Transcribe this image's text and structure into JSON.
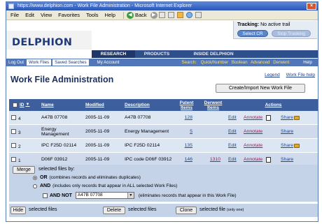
{
  "window": {
    "title": "https://www.delphion.com - Work File Administration - Microsoft Internet Explorer",
    "close_glyph": "×"
  },
  "menubar": {
    "items": [
      "File",
      "Edit",
      "View",
      "Favorites",
      "Tools",
      "Help"
    ],
    "back_label": "Back"
  },
  "tracking": {
    "label": "Tracking:",
    "status": "No active trail",
    "select_cr": "Select CR",
    "stop_tracking": "Stop Tracking"
  },
  "brand": {
    "logo": "DELPHION"
  },
  "nav": {
    "tabs": [
      "RESEARCH",
      "PRODUCTS",
      "INSIDE DELPHION"
    ]
  },
  "subnav": {
    "log_out": "Log Out",
    "work_files": "Work Files",
    "saved_searches": "Saved Searches",
    "my_account": "My Account",
    "search_label": "Search:",
    "quick_number": "Quick/Number",
    "boolean": "Boolean",
    "advanced": "Advanced",
    "derwent": "Derwent",
    "help": "Help"
  },
  "page": {
    "title": "Work File Administration",
    "legend": "Legend",
    "work_file_help": "Work File help",
    "create_button": "Create/Import New Work File"
  },
  "table": {
    "headers": {
      "id": "ID",
      "name": "Name",
      "modified": "Modified",
      "description": "Description",
      "patent_items": "Patent Items",
      "derwent_items": "Derwent Items",
      "actions": "Actions"
    },
    "rows": [
      {
        "id": "4",
        "name": "A47B 07708",
        "modified": "2005-11-09",
        "description": "A47B 07708",
        "patent_items": "128",
        "derwent_items": "",
        "edit": "Edit",
        "annotate": "Annotate",
        "share": "Share"
      },
      {
        "id": "3",
        "name": "Energy Management",
        "modified": "2005-11-09",
        "description": "Energy Management",
        "patent_items": "5",
        "derwent_items": "",
        "edit": "Edit",
        "annotate": "Annotate",
        "share": "Share"
      },
      {
        "id": "2",
        "name": "IPC F25D 02114",
        "modified": "2005-11-09",
        "description": "IPC F25D 02114",
        "patent_items": "135",
        "derwent_items": "",
        "edit": "Edit",
        "annotate": "Annotate",
        "share": "Share"
      },
      {
        "id": "1",
        "name": "D06F 03912",
        "modified": "2005-11-09",
        "description": "IPC code D06F 03912",
        "patent_items": "146",
        "derwent_items": "1310",
        "edit": "Edit",
        "annotate": "Annotate",
        "share": "Share"
      }
    ]
  },
  "merge": {
    "button": "Merge",
    "text": "selected files by:",
    "or_label": "OR",
    "or_note": "(combines records and eliminates duplicates)",
    "and_label": "AND",
    "and_note": "(includes only records that appear in ALL selected Work Files)",
    "andnot_label": "AND NOT",
    "andnot_value": "A47B 07708",
    "andnot_note": "(eliminates records that appear in this Work File)"
  },
  "bottom": {
    "hide_button": "Hide",
    "hide_text": "selected files",
    "delete_button": "Delete",
    "delete_text": "selected files",
    "clone_button": "Clone",
    "clone_text": "selected file",
    "clone_note": "(only one)"
  }
}
